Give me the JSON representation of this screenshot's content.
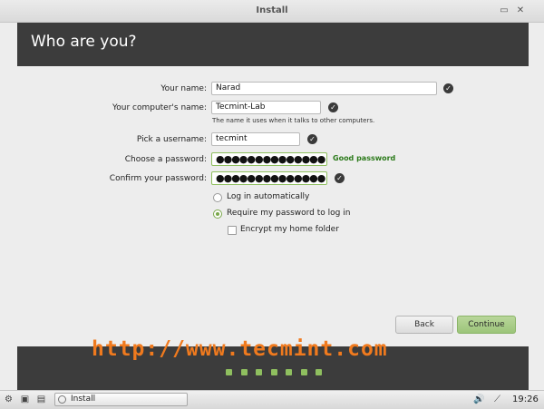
{
  "window": {
    "title": "Install",
    "minimize_icon": "minimize-icon",
    "close_icon": "close-icon"
  },
  "header": {
    "title": "Who are you?"
  },
  "form": {
    "name": {
      "label": "Your name:",
      "value": "Narad",
      "valid": true
    },
    "computer": {
      "label": "Your computer's name:",
      "value": "Tecmint-Lab",
      "hint": "The name it uses when it talks to other computers.",
      "valid": true
    },
    "username": {
      "label": "Pick a username:",
      "value": "tecmint",
      "valid": true
    },
    "password": {
      "label": "Choose a password:",
      "value": "●●●●●●●●●●●●●●",
      "strength": "Good password"
    },
    "confirm": {
      "label": "Confirm your password:",
      "value": "●●●●●●●●●●●●●●",
      "valid": true
    }
  },
  "login_options": {
    "auto": {
      "label": "Log in automatically",
      "selected": false
    },
    "require": {
      "label": "Require my password to log in",
      "selected": true
    },
    "encrypt": {
      "label": "Encrypt my home folder",
      "checked": false
    }
  },
  "buttons": {
    "back": "Back",
    "continue": "Continue"
  },
  "watermark": "http://www.tecmint.com",
  "progress": {
    "total_steps": 7
  },
  "colors": {
    "accent": "#8fbf5f",
    "header_bg": "#3c3c3c",
    "good_password": "#2b7a1a",
    "watermark": "#f07a1e"
  },
  "taskbar": {
    "task_label": "Install",
    "clock": "19:26"
  }
}
